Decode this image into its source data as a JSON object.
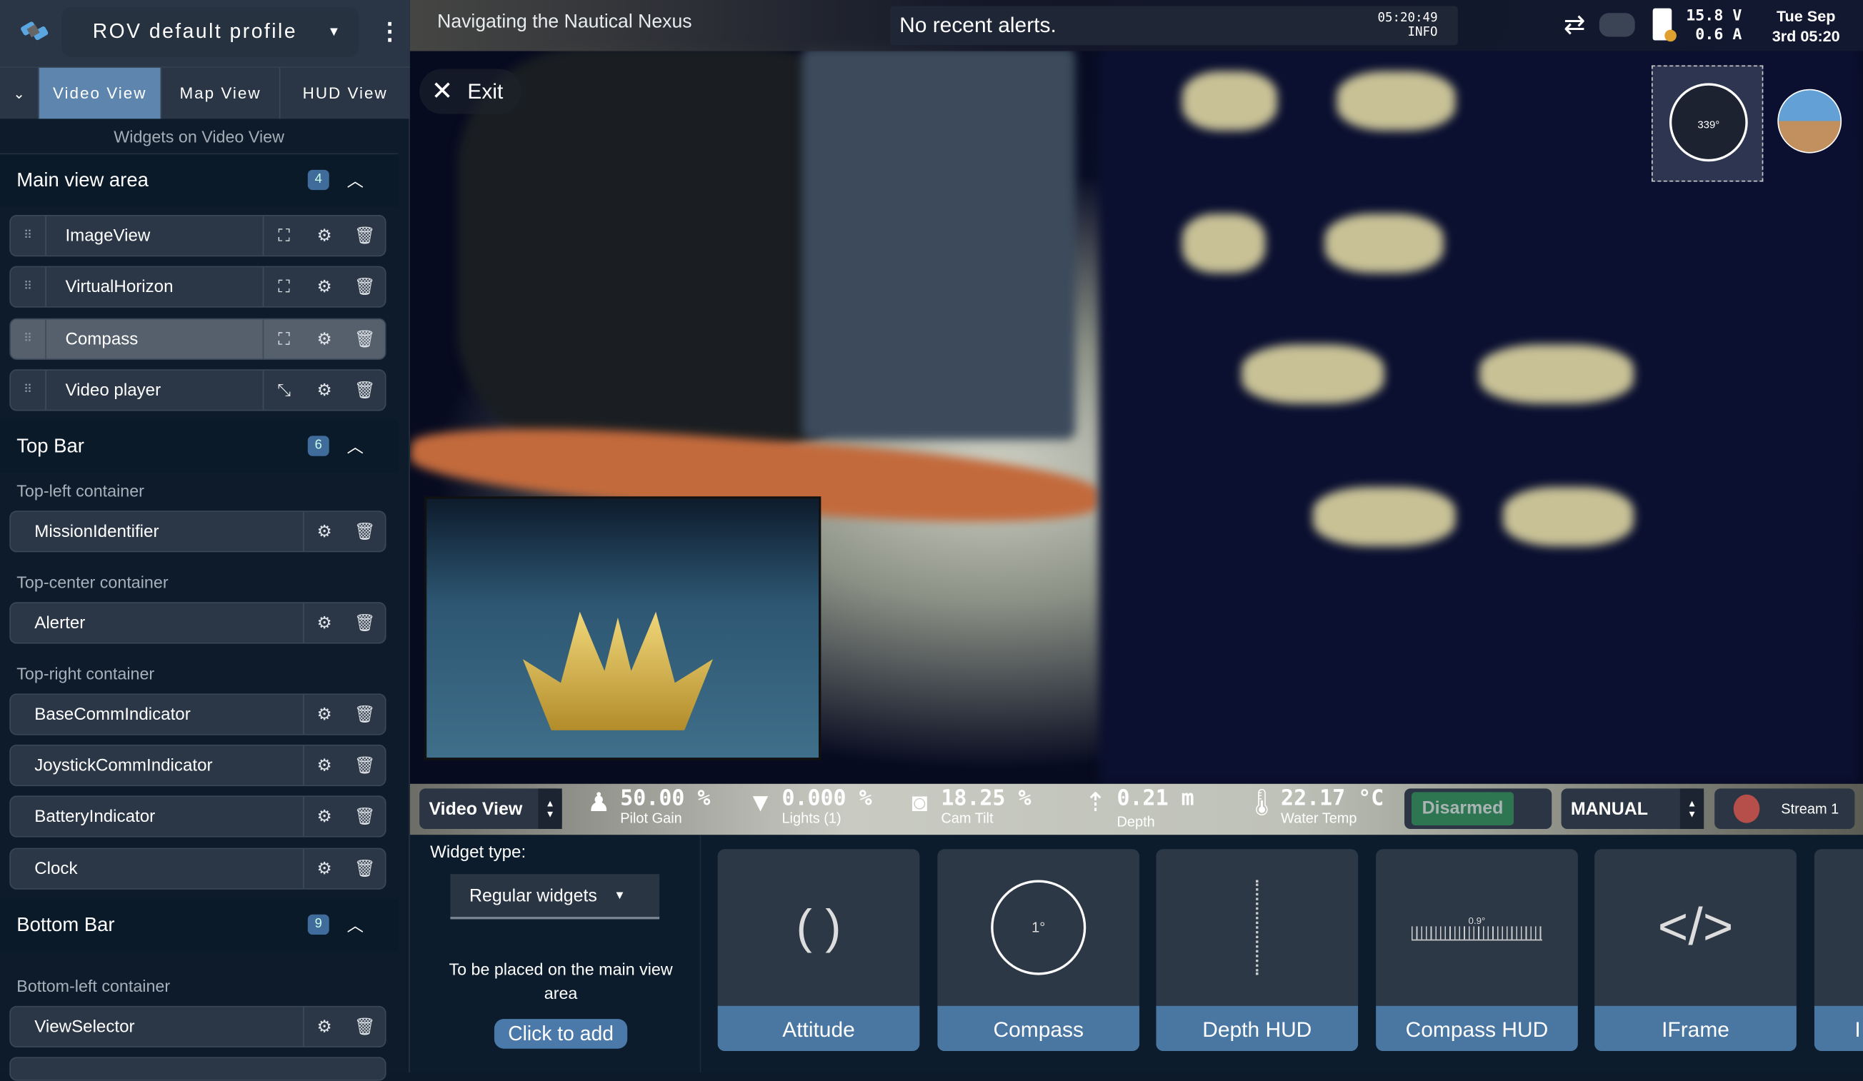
{
  "sidebar": {
    "profile_name": "ROV default profile",
    "tabs": [
      "Video View",
      "Map View",
      "HUD View"
    ],
    "active_tab": "Video View",
    "widgets_heading": "Widgets on Video View",
    "sections": [
      {
        "title": "Main view area",
        "count": "4",
        "items": [
          "ImageView",
          "VirtualHorizon",
          "Compass",
          "Video player"
        ]
      },
      {
        "title": "Top Bar",
        "count": "6",
        "containers": [
          {
            "label": "Top-left container",
            "items": [
              "MissionIdentifier"
            ]
          },
          {
            "label": "Top-center container",
            "items": [
              "Alerter"
            ]
          },
          {
            "label": "Top-right container",
            "items": [
              "BaseCommIndicator",
              "JoystickCommIndicator",
              "BatteryIndicator",
              "Clock"
            ]
          }
        ]
      },
      {
        "title": "Bottom Bar",
        "count": "9",
        "containers": [
          {
            "label": "Bottom-left container",
            "items": [
              "ViewSelector"
            ]
          }
        ]
      }
    ]
  },
  "topbar": {
    "mission": "Navigating the Nautical Nexus",
    "alert": "No recent alerts.",
    "alert_time": "05:20:49",
    "alert_level": "INFO",
    "voltage": "15.8 V",
    "current": "0.6 A",
    "date": "Tue Sep",
    "time": "3rd 05:20"
  },
  "video": {
    "exit_label": "Exit",
    "compass_heading": "339°"
  },
  "bottombar": {
    "view_selector": "Video View",
    "pilot_gain": {
      "value": "50.00 %",
      "label": "Pilot Gain"
    },
    "lights": {
      "value": "0.000 %",
      "label": "Lights (1)"
    },
    "cam_tilt": {
      "value": "18.25 %",
      "label": "Cam Tilt"
    },
    "depth": {
      "value": "0.21 m",
      "label": "Depth"
    },
    "water_temp": {
      "value": "22.17 °C",
      "label": "Water Temp"
    },
    "arm_state": "Disarmed",
    "mode": "MANUAL",
    "stream": "Stream 1"
  },
  "widget_panel": {
    "type_label": "Widget type:",
    "type_value": "Regular widgets",
    "placement": "To be placed on the main view area",
    "add_label": "Click to add",
    "cards": [
      "Attitude",
      "Compass",
      "Depth HUD",
      "Compass HUD",
      "IFrame",
      "I"
    ],
    "compass_preview": "1°",
    "compass_hud_preview": "0.9°"
  },
  "colors": {
    "accent": "#4a76a2",
    "active_tab": "#5d85ad",
    "disarmed": "#2e7551",
    "record": "#b64e4a"
  }
}
